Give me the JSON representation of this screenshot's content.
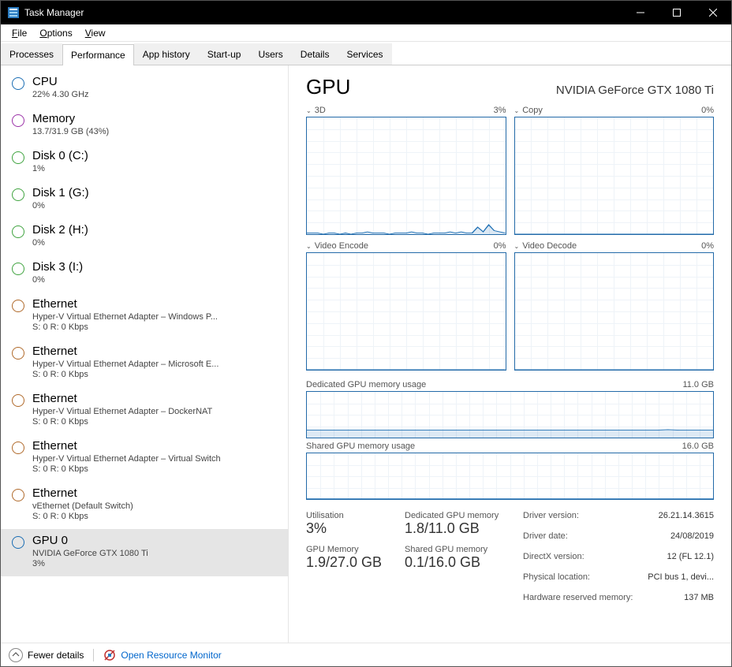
{
  "window": {
    "title": "Task Manager"
  },
  "menu": {
    "file": "File",
    "options": "Options",
    "view": "View"
  },
  "tabs": [
    "Processes",
    "Performance",
    "App history",
    "Start-up",
    "Users",
    "Details",
    "Services"
  ],
  "active_tab": 1,
  "sidebar": [
    {
      "color": "#1a6db3",
      "title": "CPU",
      "sub": "22% 4.30 GHz"
    },
    {
      "color": "#9b32a8",
      "title": "Memory",
      "sub": "13.7/31.9 GB (43%)"
    },
    {
      "color": "#3fa33f",
      "title": "Disk 0 (C:)",
      "sub": "1%"
    },
    {
      "color": "#3fa33f",
      "title": "Disk 1 (G:)",
      "sub": "0%"
    },
    {
      "color": "#3fa33f",
      "title": "Disk 2 (H:)",
      "sub": "0%"
    },
    {
      "color": "#3fa33f",
      "title": "Disk 3 (I:)",
      "sub": "0%"
    },
    {
      "color": "#b06a2b",
      "title": "Ethernet",
      "sub": "Hyper-V Virtual Ethernet Adapter – Windows P...",
      "sub2": "S: 0 R: 0 Kbps"
    },
    {
      "color": "#b06a2b",
      "title": "Ethernet",
      "sub": "Hyper-V Virtual Ethernet Adapter – Microsoft E...",
      "sub2": "S: 0 R: 0 Kbps"
    },
    {
      "color": "#b06a2b",
      "title": "Ethernet",
      "sub": "Hyper-V Virtual Ethernet Adapter – DockerNAT",
      "sub2": "S: 0 R: 0 Kbps"
    },
    {
      "color": "#b06a2b",
      "title": "Ethernet",
      "sub": "Hyper-V Virtual Ethernet Adapter – Virtual Switch",
      "sub2": "S: 0 R: 0 Kbps"
    },
    {
      "color": "#b06a2b",
      "title": "Ethernet",
      "sub": "vEthernet (Default Switch)",
      "sub2": "S: 0 R: 0 Kbps"
    },
    {
      "color": "#1a6db3",
      "title": "GPU 0",
      "sub": "NVIDIA GeForce GTX 1080 Ti",
      "sub2": "3%",
      "selected": true
    }
  ],
  "main": {
    "title": "GPU",
    "device": "NVIDIA GeForce GTX 1080 Ti",
    "charts_top": [
      {
        "name": "3D",
        "pct": "3%"
      },
      {
        "name": "Copy",
        "pct": "0%"
      }
    ],
    "charts_mid": [
      {
        "name": "Video Encode",
        "pct": "0%"
      },
      {
        "name": "Video Decode",
        "pct": "0%"
      }
    ],
    "mem1": {
      "label": "Dedicated GPU memory usage",
      "max": "11.0 GB"
    },
    "mem2": {
      "label": "Shared GPU memory usage",
      "max": "16.0 GB"
    },
    "stats": {
      "util_label": "Utilisation",
      "util": "3%",
      "gpumem_label": "GPU Memory",
      "gpumem": "1.9/27.0 GB",
      "dedmem_label": "Dedicated GPU memory",
      "dedmem": "1.8/11.0 GB",
      "shrmem_label": "Shared GPU memory",
      "shrmem": "0.1/16.0 GB"
    },
    "info": [
      {
        "k": "Driver version:",
        "v": "26.21.14.3615"
      },
      {
        "k": "Driver date:",
        "v": "24/08/2019"
      },
      {
        "k": "DirectX version:",
        "v": "12 (FL 12.1)"
      },
      {
        "k": "Physical location:",
        "v": "PCI bus 1, devi..."
      },
      {
        "k": "Hardware reserved memory:",
        "v": "137 MB"
      }
    ]
  },
  "footer": {
    "fewer": "Fewer details",
    "orm": "Open Resource Monitor"
  },
  "chart_data": [
    {
      "type": "line",
      "title": "3D",
      "ylim": [
        0,
        100
      ],
      "series": [
        {
          "name": "3D",
          "values": [
            1,
            1,
            1,
            0,
            1,
            1,
            0,
            1,
            0,
            1,
            1,
            2,
            1,
            1,
            1,
            0,
            1,
            1,
            1,
            2,
            1,
            1,
            0,
            1,
            1,
            1,
            2,
            1,
            2,
            1,
            1,
            6,
            2,
            8,
            3,
            2,
            1
          ]
        }
      ]
    },
    {
      "type": "line",
      "title": "Copy",
      "ylim": [
        0,
        100
      ],
      "series": [
        {
          "name": "Copy",
          "values": [
            0,
            0,
            0,
            0,
            0,
            0,
            0,
            0,
            0,
            0,
            0,
            0,
            0,
            0,
            0,
            0,
            0,
            0,
            0,
            0,
            0,
            0,
            0,
            0,
            0,
            0,
            0,
            0,
            0,
            0,
            0,
            0,
            0,
            0,
            0,
            0,
            0
          ]
        }
      ]
    },
    {
      "type": "line",
      "title": "Video Encode",
      "ylim": [
        0,
        100
      ],
      "series": [
        {
          "name": "Video Encode",
          "values": [
            0,
            0,
            0,
            0,
            0,
            0,
            0,
            0,
            0,
            0,
            0,
            0,
            0,
            0,
            0,
            0,
            0,
            0,
            0,
            0,
            0,
            0,
            0,
            0,
            0,
            0,
            0,
            0,
            0,
            0,
            0,
            0,
            0,
            0,
            0,
            0,
            0
          ]
        }
      ]
    },
    {
      "type": "line",
      "title": "Video Decode",
      "ylim": [
        0,
        100
      ],
      "series": [
        {
          "name": "Video Decode",
          "values": [
            0,
            0,
            0,
            0,
            0,
            0,
            0,
            0,
            0,
            0,
            0,
            0,
            0,
            0,
            0,
            0,
            0,
            0,
            0,
            0,
            0,
            0,
            0,
            0,
            0,
            0,
            0,
            0,
            0,
            0,
            0,
            0,
            0,
            0,
            0,
            0,
            0
          ]
        }
      ]
    },
    {
      "type": "line",
      "title": "Dedicated GPU memory usage",
      "ylim": [
        0,
        11
      ],
      "ylabel": "GB",
      "series": [
        {
          "name": "Dedicated",
          "values": [
            1.8,
            1.8,
            1.8,
            1.8,
            1.8,
            1.8,
            1.8,
            1.8,
            1.8,
            1.8,
            1.8,
            1.8,
            1.8,
            1.8,
            1.8,
            1.8,
            1.8,
            1.8,
            1.8,
            1.8,
            1.8,
            1.8,
            1.8,
            1.8,
            1.8,
            1.8,
            1.8,
            1.8,
            1.8,
            1.8,
            1.8,
            1.8,
            1.9,
            1.8,
            1.8,
            1.8,
            1.8
          ]
        }
      ]
    },
    {
      "type": "line",
      "title": "Shared GPU memory usage",
      "ylim": [
        0,
        16
      ],
      "ylabel": "GB",
      "series": [
        {
          "name": "Shared",
          "values": [
            0.1,
            0.1,
            0.1,
            0.1,
            0.1,
            0.1,
            0.1,
            0.1,
            0.1,
            0.1,
            0.1,
            0.1,
            0.1,
            0.1,
            0.1,
            0.1,
            0.1,
            0.1,
            0.1,
            0.1,
            0.1,
            0.1,
            0.1,
            0.1,
            0.1,
            0.1,
            0.1,
            0.1,
            0.1,
            0.1,
            0.1,
            0.1,
            0.1,
            0.1,
            0.1,
            0.1,
            0.1
          ]
        }
      ]
    }
  ]
}
